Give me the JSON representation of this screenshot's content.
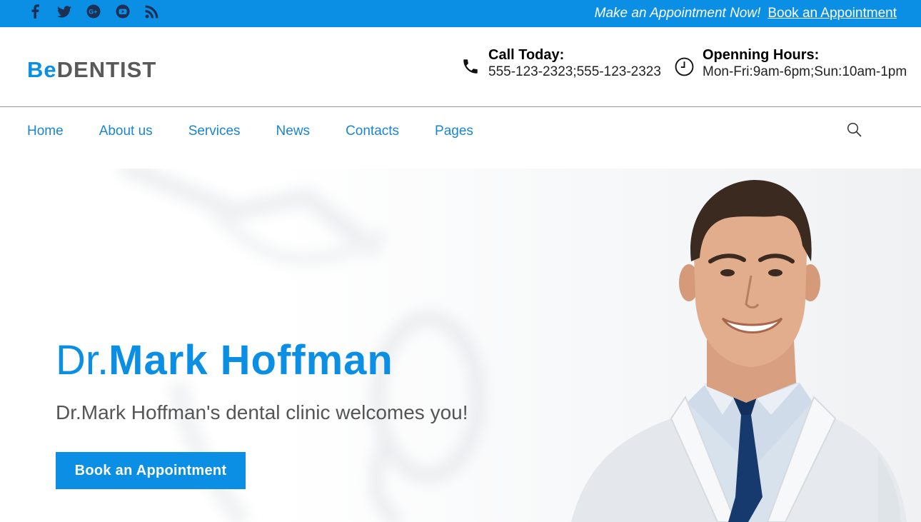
{
  "topbar": {
    "social_icons": [
      "facebook-icon",
      "twitter-icon",
      "google-plus-icon",
      "youtube-icon",
      "rss-icon"
    ],
    "cta_text": "Make an Appointment Now!",
    "book_link": "Book an Appointment"
  },
  "header": {
    "logo_be": "Be",
    "logo_dentist": "DENTIST",
    "call": {
      "icon": "phone-icon",
      "title": "Call Today:",
      "value": "555-123-2323;555-123-2323"
    },
    "hours": {
      "icon": "clock-icon",
      "title": "Openning Hours:",
      "value": "Mon-Fri:9am-6pm;Sun:10am-1pm"
    }
  },
  "nav": {
    "items": [
      "Home",
      "About us",
      "Services",
      "News",
      "Contacts",
      "Pages"
    ],
    "search_icon": "search-icon"
  },
  "hero": {
    "title_prefix": "Dr.",
    "title_name": "Mark Hoffman",
    "subtitle": "Dr.Mark Hoffman's dental clinic welcomes you!",
    "button": "Book an Appointment"
  },
  "colors": {
    "brand_blue": "#0a8fe4",
    "nav_blue": "#1a86d2",
    "logo_gray": "#595959",
    "text_gray": "#555555"
  }
}
